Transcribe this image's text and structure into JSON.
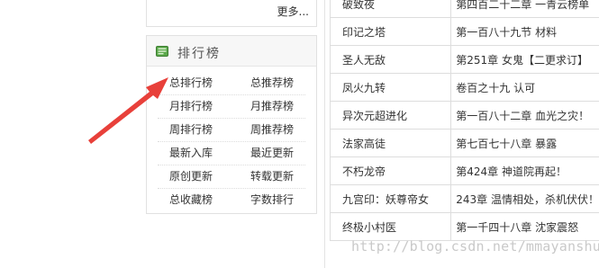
{
  "more_label": "更多...",
  "rank_panel": {
    "title": "排行榜",
    "rows": [
      [
        "总排行榜",
        "总推荐榜"
      ],
      [
        "月排行榜",
        "月推荐榜"
      ],
      [
        "周排行榜",
        "周推荐榜"
      ],
      [
        "最新入库",
        "最近更新"
      ],
      [
        "原创更新",
        "转载更新"
      ],
      [
        "总收藏榜",
        "字数排行"
      ]
    ]
  },
  "book_list": [
    {
      "name": "破致夜",
      "chapter": "第四百二十二章 一青云榜单"
    },
    {
      "name": "印记之塔",
      "chapter": "第一百八十九节 材料"
    },
    {
      "name": "圣人无敌",
      "chapter": "第251章 女鬼【二更求订】"
    },
    {
      "name": "凤火九转",
      "chapter": "卷百之十九 认可"
    },
    {
      "name": "异次元超进化",
      "chapter": "第一百八十二章 血光之灾！"
    },
    {
      "name": "法家高徒",
      "chapter": "第七百七十八章 暴露"
    },
    {
      "name": "不朽龙帝",
      "chapter": "第424章 神道院再起！"
    },
    {
      "name": "九宫印：妖尊帝女",
      "chapter": "243章 温情相处，杀机伏伏！"
    },
    {
      "name": "终极小村医",
      "chapter": "第一千四十八章 沈家震怒"
    }
  ],
  "watermark": "http://blog.csdn.net/mmayanshuo",
  "colors": {
    "arrow": "#e8403a",
    "book_icon": "#4a9a3c",
    "border": "#dddddd"
  },
  "icons": {
    "rank_icon": "book-icon",
    "annotation": "red-arrow"
  }
}
